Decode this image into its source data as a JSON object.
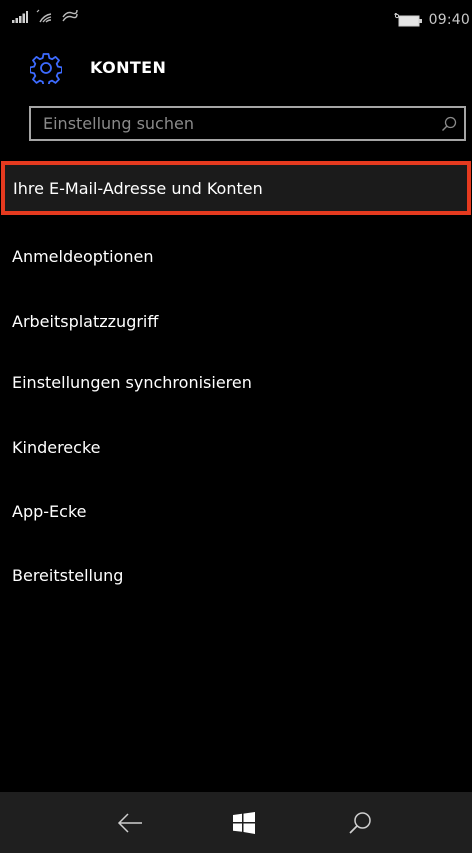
{
  "status_bar": {
    "time": "09:40",
    "icons": [
      "signal-icon",
      "wifi-icon",
      "data-sense-icon",
      "battery-icon"
    ]
  },
  "header": {
    "title": "KONTEN",
    "icon": "gear-icon",
    "accent_color": "#3d6bff"
  },
  "search": {
    "placeholder": "Einstellung suchen",
    "icon": "search-icon"
  },
  "menu": {
    "items": [
      {
        "label": "Ihre E-Mail-Adresse und Konten",
        "selected": true
      },
      {
        "label": "Anmeldeoptionen"
      },
      {
        "label": "Arbeitsplatzzugriff"
      },
      {
        "label": "Einstellungen synchronisieren"
      },
      {
        "label": "Kinderecke"
      },
      {
        "label": "App-Ecke"
      },
      {
        "label": "Bereitstellung"
      }
    ],
    "highlight_color": "#e53a1f"
  },
  "nav_bar": {
    "buttons": [
      "back-icon",
      "windows-icon",
      "search-icon"
    ]
  }
}
